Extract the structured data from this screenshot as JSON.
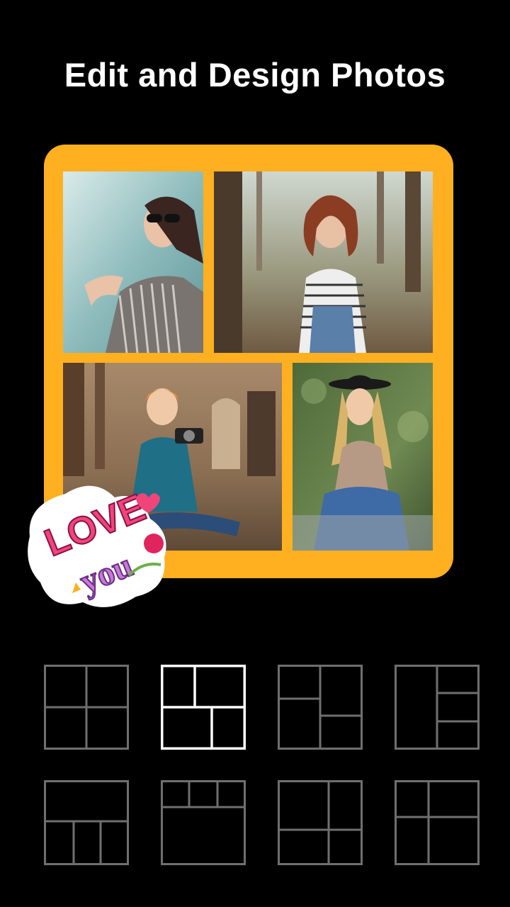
{
  "header": {
    "title": "Edit and Design Photos"
  },
  "collage": {
    "frame_color": "#FFB020",
    "photos": [
      {
        "name": "woman-in-sunglasses-photo"
      },
      {
        "name": "curly-haired-woman-in-park-photo"
      },
      {
        "name": "woman-with-camera-photo"
      },
      {
        "name": "blonde-woman-in-hat-photo"
      }
    ],
    "sticker": {
      "text_line1": "LOVE",
      "text_line2": "you"
    }
  },
  "layouts": {
    "selected_index": 1,
    "items": [
      {
        "name": "grid-2x2"
      },
      {
        "name": "grid-top-split-bottom-split"
      },
      {
        "name": "grid-left-tall-right-stack"
      },
      {
        "name": "grid-left-column-right-three"
      },
      {
        "name": "grid-top-wide-bottom-three"
      },
      {
        "name": "grid-top-three-bottom-wide"
      },
      {
        "name": "grid-2x2-offset"
      },
      {
        "name": "grid-left-two-right-two"
      }
    ]
  }
}
